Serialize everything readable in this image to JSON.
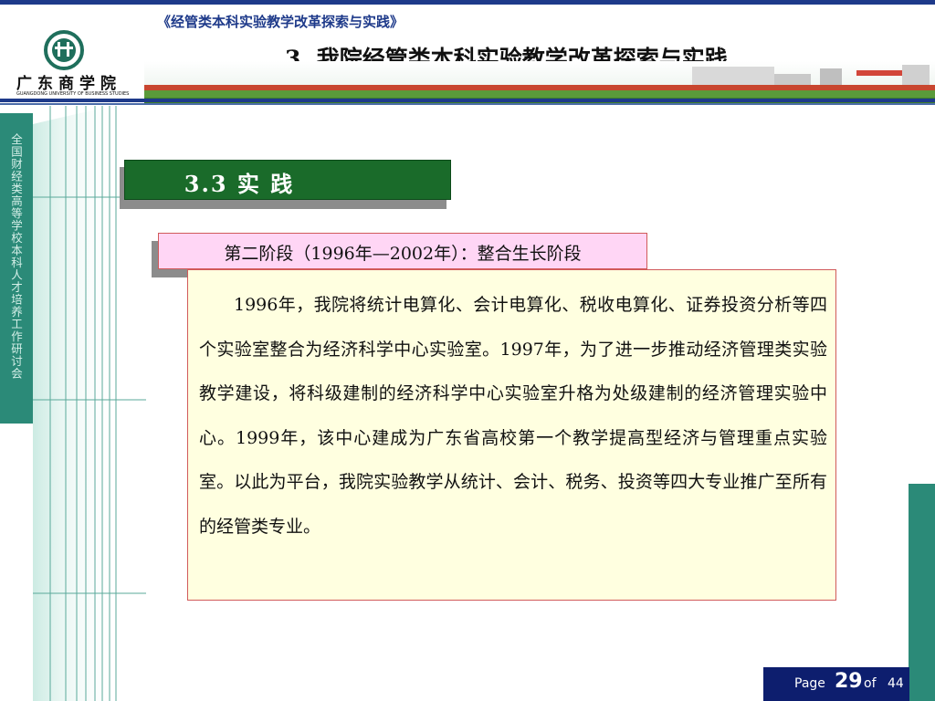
{
  "header": {
    "course_title": "《经管类本科实验教学改革探索与实践》",
    "slide_title": "3.  我院经管类本科实验教学改革探索与实践"
  },
  "logo": {
    "name": "广东商学院",
    "subtitle": "GUANGDONG UNIVERSITY OF BUSINESS STUDIES"
  },
  "sidebar": {
    "vertical_text": "全国财经类高等学校本科人才培养工作研讨会"
  },
  "section": {
    "label": "3.3 实 践"
  },
  "stage": {
    "label": "第二阶段（1996年—2002年）：整合生长阶段"
  },
  "content": {
    "paragraph": "1996年，我院将统计电算化、会计电算化、税收电算化、证券投资分析等四个实验室整合为经济科学中心实验室。1997年，为了进一步推动经济管理类实验教学建设，将科级建制的经济科学中心实验室升格为处级建制的经济管理实验中心。1999年，该中心建成为广东省高校第一个教学提高型经济与管理重点实验室。以此为平台，我院实验教学从统计、会计、税务、投资等四大专业推广至所有的经管类专业。"
  },
  "pager": {
    "page_word": "Page",
    "current": "29",
    "of_word": "of",
    "total": "44"
  },
  "colors": {
    "navy": "#1e3a8a",
    "teal": "#2b8a78",
    "section_green": "#1a6b2a",
    "stage_pink": "#ffd6f5",
    "content_yellow": "#ffffe0",
    "border_red": "#d15a5a"
  }
}
